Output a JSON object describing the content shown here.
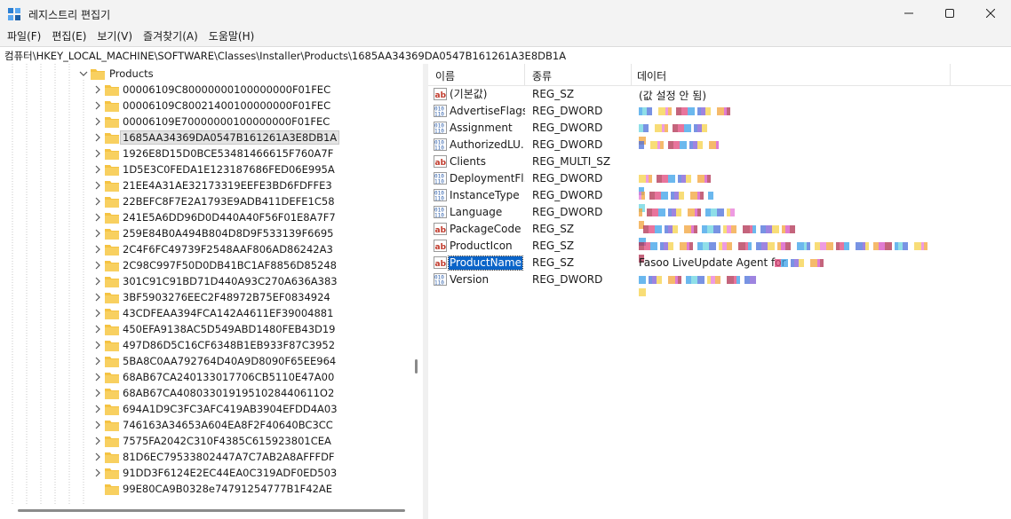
{
  "window": {
    "title": "레지스트리 편집기"
  },
  "menu": [
    "파일(F)",
    "편집(E)",
    "보기(V)",
    "즐겨찾기(A)",
    "도움말(H)"
  ],
  "address": "컴퓨터\\HKEY_LOCAL_MACHINE\\SOFTWARE\\Classes\\Installer\\Products\\1685AA34369DA0547B161261A3E8DB1A",
  "tree": {
    "parent": "Products",
    "selected_index": 3,
    "children": [
      "00006109C80000000100000000F01FEC",
      "00006109C80021400100000000F01FEC",
      "00006109E70000000100000000F01FEC",
      "1685AA34369DA0547B161261A3E8DB1A",
      "1926E8D15D0BCE53481466615F760A7F",
      "1D5E3C0FEDA1E123187686FED06E995A",
      "21EE4A31AE32173319EEFE3BD6FDFFE3",
      "22BEFC8F7E2A1793E9ADB411DEFE1C58",
      "241E5A6DD96D0D440A40F56F01E8A7F7",
      "259E84B0A494B804D8D9F533139F6695",
      "2C4F6FC49739F2548AAF806AD86242A3",
      "2C98C997F50D0DB41BC1AF8856D85248",
      "301C91C91BD71D440A93C270A636A383",
      "3BF5903276EEC2F48972B75EF0834924",
      "43CDFEAA394FCA142A4611EF39004881",
      "450EFA9138AC5D549ABD1480FEB43D19",
      "497D86D5C16CF6348B1EB933F87C3952",
      "5BA8C0AA792764D40A9D8090F65EE964",
      "68AB67CA240133017706CB5110E47A00",
      "68AB67CA4080330191951028440611O2",
      "694A1D9C3FC3AFC419AB3904EFDD4A03",
      "746163A34653A604EA8F2F40640BC3CC",
      "7575FA2042C310F4385C615923801CEA",
      "81D6EC79533802447A7C7AB2A8AFFFDF",
      "91DD3F6124E2EC44EA0C319ADF0ED503",
      "99E80CA9B0328e74791254777B1F42AE"
    ]
  },
  "values_table": {
    "columns": [
      "이름",
      "종류",
      "데이터"
    ],
    "selected_index": 10,
    "rows": [
      {
        "name": "(기본값)",
        "type": "REG_SZ",
        "data": "(값 설정 안 됨)",
        "icon": "string-value-icon"
      },
      {
        "name": "AdvertiseFlags",
        "type": "REG_DWORD",
        "data": "",
        "icon": "binary-value-icon"
      },
      {
        "name": "Assignment",
        "type": "REG_DWORD",
        "data": "",
        "icon": "binary-value-icon"
      },
      {
        "name": "AuthorizedLU...",
        "type": "REG_DWORD",
        "data": "",
        "icon": "binary-value-icon"
      },
      {
        "name": "Clients",
        "type": "REG_MULTI_SZ",
        "data": "",
        "icon": "string-value-icon"
      },
      {
        "name": "DeploymentFl...",
        "type": "REG_DWORD",
        "data": "",
        "icon": "binary-value-icon"
      },
      {
        "name": "InstanceType",
        "type": "REG_DWORD",
        "data": "",
        "icon": "binary-value-icon"
      },
      {
        "name": "Language",
        "type": "REG_DWORD",
        "data": "",
        "icon": "binary-value-icon"
      },
      {
        "name": "PackageCode",
        "type": "REG_SZ",
        "data": "",
        "icon": "string-value-icon"
      },
      {
        "name": "ProductIcon",
        "type": "REG_SZ",
        "data": "",
        "icon": "string-value-icon"
      },
      {
        "name": "ProductName",
        "type": "REG_SZ",
        "data": "Fasoo LiveUpdate Agent for",
        "icon": "string-value-icon"
      },
      {
        "name": "Version",
        "type": "REG_DWORD",
        "data": "",
        "icon": "binary-value-icon"
      }
    ]
  },
  "icons": {
    "app": "registry-editor-icon",
    "folder": "folder-icon",
    "chevron": "chevron-right-icon"
  },
  "colors": {
    "folder": "#f5c342",
    "selection": "#0a64c8",
    "string_icon": "#c0392b",
    "binary_icon": "#2a5caa"
  }
}
